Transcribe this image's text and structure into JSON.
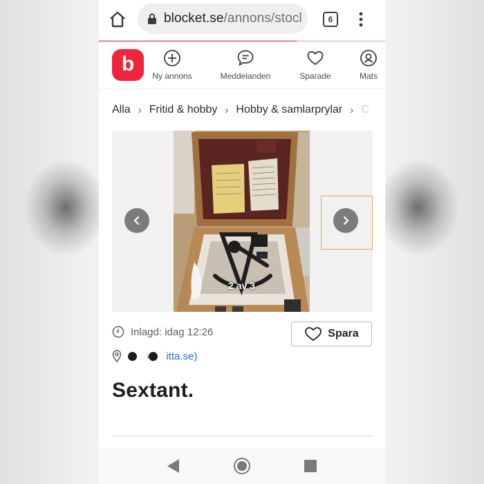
{
  "browser": {
    "url_domain": "blocket.se",
    "url_path": "/annons/stocl",
    "tab_count": "6",
    "icons": {
      "home": "home-icon",
      "lock": "lock-icon",
      "tabs": "tab-switcher-icon",
      "menu": "more-vert-icon"
    },
    "page_load_progress": 0.69
  },
  "site_nav": {
    "logo_letter": "b",
    "items": [
      {
        "label": "Ny annons",
        "icon": "plus-circle-icon"
      },
      {
        "label": "Meddelanden",
        "icon": "chat-bubble-icon"
      },
      {
        "label": "Sparade",
        "icon": "heart-icon"
      },
      {
        "label": "Mats",
        "icon": "user-circle-icon"
      }
    ]
  },
  "breadcrumb": {
    "items": [
      "Alla",
      "Fritid & hobby",
      "Hobby & samlarprylar"
    ],
    "overflow_letter": "C"
  },
  "gallery": {
    "counter": "2 av 3",
    "prev_icon": "chevron-left-icon",
    "next_icon": "chevron-right-icon"
  },
  "listing": {
    "posted": "Inlagd: idag 12:26",
    "save_label": "Spara",
    "location_text": "itta.se)",
    "title": "Sextant."
  },
  "system_nav": {
    "back": "back-triangle-icon",
    "home": "home-circle-icon",
    "recents": "recents-square-icon"
  },
  "colors": {
    "brand": "#f0243a",
    "link": "#2a6ed3",
    "focus_outline": "#f2a64e"
  }
}
